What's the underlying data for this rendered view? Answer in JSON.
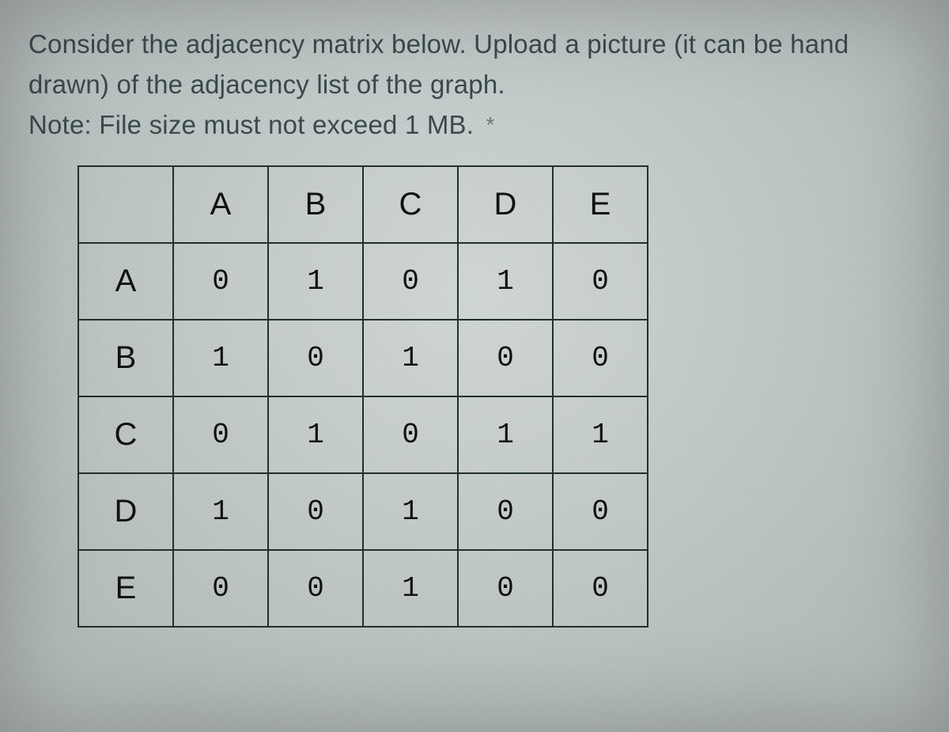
{
  "prompt": {
    "line1": "Consider the adjacency matrix below. Upload a picture (it can be hand",
    "line2": "drawn) of the adjacency list of the graph.",
    "line3": "Note: File size must not exceed 1 MB.",
    "required_mark": "*"
  },
  "matrix": {
    "col_headers": [
      "A",
      "B",
      "C",
      "D",
      "E"
    ],
    "row_headers": [
      "A",
      "B",
      "C",
      "D",
      "E"
    ],
    "rows": [
      [
        "0",
        "1",
        "0",
        "1",
        "0"
      ],
      [
        "1",
        "0",
        "1",
        "0",
        "0"
      ],
      [
        "0",
        "1",
        "0",
        "1",
        "1"
      ],
      [
        "1",
        "0",
        "1",
        "0",
        "0"
      ],
      [
        "0",
        "0",
        "1",
        "0",
        "0"
      ]
    ]
  },
  "chart_data": {
    "type": "table",
    "title": "Adjacency matrix",
    "categories": [
      "A",
      "B",
      "C",
      "D",
      "E"
    ],
    "series": [
      {
        "name": "A",
        "values": [
          0,
          1,
          0,
          1,
          0
        ]
      },
      {
        "name": "B",
        "values": [
          1,
          0,
          1,
          0,
          0
        ]
      },
      {
        "name": "C",
        "values": [
          0,
          1,
          0,
          1,
          1
        ]
      },
      {
        "name": "D",
        "values": [
          1,
          0,
          1,
          0,
          0
        ]
      },
      {
        "name": "E",
        "values": [
          0,
          0,
          1,
          0,
          0
        ]
      }
    ]
  }
}
